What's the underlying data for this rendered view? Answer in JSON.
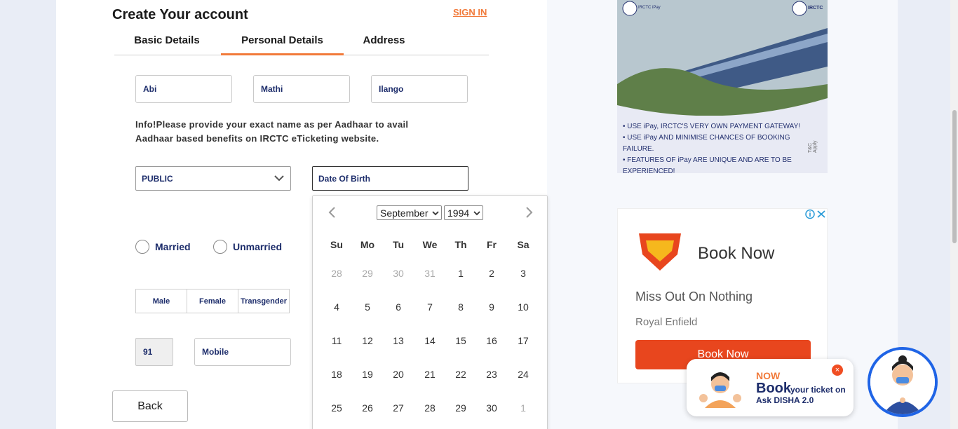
{
  "form": {
    "title": "Create Your account",
    "signin": "SIGN IN",
    "tabs": [
      "Basic Details",
      "Personal Details",
      "Address"
    ],
    "first_name": "Abi",
    "middle_name": "Mathi",
    "last_name": "Ilango",
    "info": "Info!Please provide your exact name as per Aadhaar to avail Aadhaar based benefits on IRCTC eTicketing website.",
    "occupation": "PUBLIC",
    "dob_placeholder": "Date Of Birth",
    "marital": [
      "Married",
      "Unmarried"
    ],
    "gender": [
      "Male",
      "Female",
      "Transgender"
    ],
    "country_code": "91",
    "mobile_placeholder": "Mobile",
    "back": "Back"
  },
  "calendar": {
    "month": "September",
    "year": "1994",
    "weekdays": [
      "Su",
      "Mo",
      "Tu",
      "We",
      "Th",
      "Fr",
      "Sa"
    ],
    "weeks": [
      [
        {
          "d": "28",
          "m": true
        },
        {
          "d": "29",
          "m": true
        },
        {
          "d": "30",
          "m": true
        },
        {
          "d": "31",
          "m": true
        },
        {
          "d": "1"
        },
        {
          "d": "2"
        },
        {
          "d": "3"
        }
      ],
      [
        {
          "d": "4"
        },
        {
          "d": "5"
        },
        {
          "d": "6"
        },
        {
          "d": "7"
        },
        {
          "d": "8"
        },
        {
          "d": "9"
        },
        {
          "d": "10"
        }
      ],
      [
        {
          "d": "11"
        },
        {
          "d": "12"
        },
        {
          "d": "13"
        },
        {
          "d": "14"
        },
        {
          "d": "15"
        },
        {
          "d": "16"
        },
        {
          "d": "17"
        }
      ],
      [
        {
          "d": "18"
        },
        {
          "d": "19"
        },
        {
          "d": "20"
        },
        {
          "d": "21"
        },
        {
          "d": "22"
        },
        {
          "d": "23"
        },
        {
          "d": "24"
        }
      ],
      [
        {
          "d": "25"
        },
        {
          "d": "26"
        },
        {
          "d": "27"
        },
        {
          "d": "28"
        },
        {
          "d": "29"
        },
        {
          "d": "30"
        },
        {
          "d": "1",
          "m": true
        }
      ]
    ]
  },
  "ad1": {
    "logo_left": "IRCTC iPay",
    "logo_right": "IRCTC",
    "lines": [
      "• USE iPay, IRCTC'S VERY OWN PAYMENT GATEWAY!",
      "• USE iPay AND MINIMISE CHANCES OF BOOKING FAILURE.",
      "• FEATURES OF iPay ARE UNIQUE AND ARE TO BE EXPERIENCED!"
    ],
    "tc": "T&C Apply"
  },
  "ad2": {
    "headline": "Book Now",
    "tagline": "Miss Out On Nothing",
    "brand": "Royal Enfield",
    "button": "Book Now"
  },
  "disha": {
    "now": "NOW",
    "book": "Book",
    "rest": "your ticket on",
    "ask": "Ask DISHA 2.0",
    "close": "×"
  },
  "colors": {
    "accent": "#f17a3a",
    "navy": "#1d2d6b",
    "ad_button": "#e8461e",
    "avatar_ring": "#1f64e6"
  }
}
